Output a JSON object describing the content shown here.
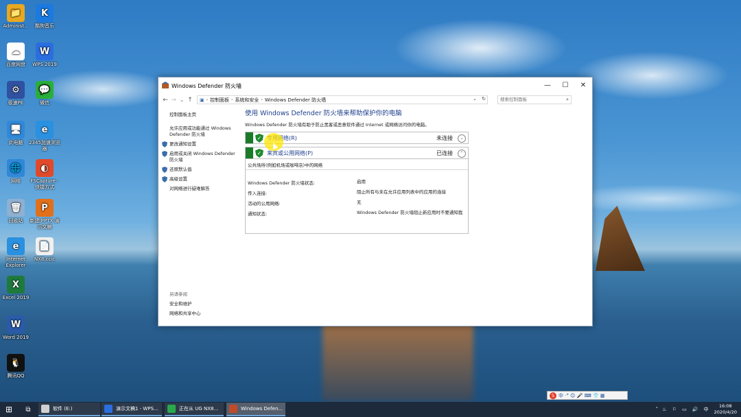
{
  "desktop": {
    "icons": [
      {
        "label": "Administ...",
        "name": "administrator-folder-icon",
        "color": "#e8a820",
        "glyph": "📁"
      },
      {
        "label": "酷狗音乐",
        "name": "kugou-music-icon",
        "color": "#1a7ae0",
        "glyph": "K"
      },
      {
        "label": "百度网盘",
        "name": "baidu-netdisk-icon",
        "color": "#ffffff",
        "glyph": "☁"
      },
      {
        "label": "WPS 2019",
        "name": "wps-icon",
        "color": "#2a6ee0",
        "glyph": "W"
      },
      {
        "label": "极速PE",
        "name": "pe-tool-icon",
        "color": "#3050a0",
        "glyph": "⚙"
      },
      {
        "label": "微信",
        "name": "wechat-icon",
        "color": "#2aae3a",
        "glyph": "💬"
      },
      {
        "label": "此电脑",
        "name": "this-pc-icon",
        "color": "#2f88d8",
        "glyph": "🖥"
      },
      {
        "label": "2345加速浏览器",
        "name": "browser-2345-icon",
        "color": "#2a90e0",
        "glyph": "e"
      },
      {
        "label": "网络",
        "name": "network-icon",
        "color": "#2f88d8",
        "glyph": "🌐"
      },
      {
        "label": "FSCapture - 快捷方式",
        "name": "fscapture-icon",
        "color": "#e04a2a",
        "glyph": "◐"
      },
      {
        "label": "回收站",
        "name": "recycle-bin-icon",
        "color": "#8fb0d0",
        "glyph": "🗑"
      },
      {
        "label": "新建 PPTX 演示文稿",
        "name": "pptx-file-icon",
        "color": "#e0701a",
        "glyph": "P"
      },
      {
        "label": "Internet Explorer",
        "name": "internet-explorer-icon",
        "color": "#2a90e0",
        "glyph": "e"
      },
      {
        "label": "NX8.ccic",
        "name": "nx-file-icon",
        "color": "#f0f0f0",
        "glyph": "📄"
      },
      {
        "label": "Excel 2019",
        "name": "excel-icon",
        "color": "#1e7a3c",
        "glyph": "X"
      },
      {
        "label": "Word 2019",
        "name": "word-icon",
        "color": "#2a5aa8",
        "glyph": "W"
      },
      {
        "label": "腾讯QQ",
        "name": "qq-icon",
        "color": "#111111",
        "glyph": "🐧"
      }
    ]
  },
  "window": {
    "title": "Windows Defender 防火墙",
    "controls": {
      "minimize": "—",
      "maximize": "☐",
      "close": "✕"
    },
    "address": {
      "back": "←",
      "forward": "→",
      "recent": "⌄",
      "up": "↑",
      "crumbs": [
        "控制面板",
        "系统和安全",
        "Windows Defender 防火墙"
      ],
      "dropdown": "⌄",
      "refresh": "↻"
    },
    "search": {
      "placeholder": "搜索控制面板",
      "icon": "⌕"
    },
    "left_pane": {
      "home": "控制面板主页",
      "items": [
        {
          "label": "允许应用或功能通过 Windows Defender 防火墙",
          "shield": false
        },
        {
          "label": "更改通知设置",
          "shield": true
        },
        {
          "label": "启用或关闭 Windows Defender 防火墙",
          "shield": true
        },
        {
          "label": "还原默认值",
          "shield": true
        },
        {
          "label": "高级设置",
          "shield": true
        },
        {
          "label": "对网络进行疑难解答",
          "shield": false
        }
      ],
      "see_also_title": "另请参阅",
      "see_also": [
        "安全和维护",
        "网络和共享中心"
      ]
    },
    "content": {
      "heading": "使用 Windows Defender 防火墙来帮助保护你的电脑",
      "description": "Windows Defender 防火墙有助于防止黑客或恶意软件通过 Internet 或网络访问你的电脑。",
      "private_network": {
        "label": "专用网络(R)",
        "status": "未连接",
        "chevron": "⌄"
      },
      "public_network": {
        "label": "来宾或公用网络(P)",
        "status": "已连接",
        "chevron": "⌃"
      },
      "public_desc": "公共场所(例如机场或咖啡店)中的网络",
      "details": [
        {
          "key": "Windows Defender 防火墙状态:",
          "value": "启用"
        },
        {
          "key": "传入连接:",
          "value": "阻止所有与未在允许应用列表中的应用的连接"
        },
        {
          "key": "活动的公用网络:",
          "value": "无"
        },
        {
          "key": "通知状态:",
          "value": "Windows Defender 防火墙阻止新应用时不要通知我"
        }
      ]
    }
  },
  "taskbar": {
    "start": "⊞",
    "taskview": "⧉",
    "tasks": [
      {
        "label": "软件 (E:)",
        "name": "task-explorer-e",
        "color": "#d0d0d0"
      },
      {
        "label": "演示文稿1 - WPS...",
        "name": "task-wps",
        "color": "#2a6ee0"
      },
      {
        "label": "正在从 UG NX8...",
        "name": "task-ug-nx",
        "color": "#2aa84a"
      },
      {
        "label": "Windows Defen...",
        "name": "task-defender",
        "color": "#c04a2a"
      }
    ],
    "ime": {
      "logo": "S",
      "items": "中 ·° ☺ 🎤 ⌨ 👕 ▦"
    },
    "tray": {
      "up": "˄",
      "icons": "♨ ⚐ ▭ 🔊",
      "lang": "中"
    },
    "time": "16:08",
    "date": "2020/4/20"
  }
}
